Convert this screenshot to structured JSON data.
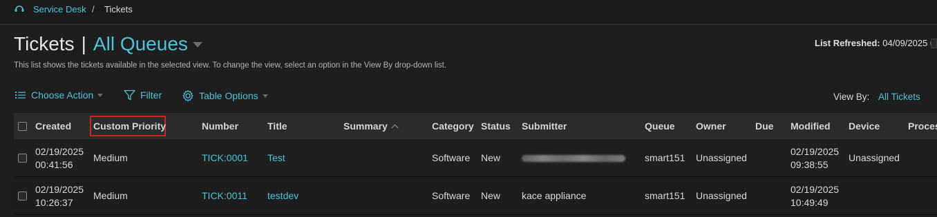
{
  "breadcrumb": {
    "home": "Service Desk",
    "separator": "/",
    "current": "Tickets"
  },
  "header": {
    "title": "Tickets",
    "divider": "|",
    "queue": "All Queues",
    "subtitle": "This list shows the tickets available in the selected view. To change the view, select an option in the View By drop-down list.",
    "refreshed_label": "List Refreshed:",
    "refreshed_value": "04/09/2025 0"
  },
  "toolbar": {
    "choose_action": "Choose Action",
    "filter": "Filter",
    "table_options": "Table Options",
    "view_by_label": "View By:",
    "view_by_value": "All Tickets"
  },
  "table": {
    "columns": [
      "Created",
      "Custom Priority",
      "Number",
      "Title",
      "Summary",
      "Category",
      "Status",
      "Submitter",
      "Queue",
      "Owner",
      "Due",
      "Modified",
      "Device",
      "Proces"
    ],
    "rows": [
      {
        "created_date": "02/19/2025",
        "created_time": "00:41:56",
        "priority": "Medium",
        "number": "TICK:0001",
        "title": "Test",
        "summary": "",
        "category": "Software",
        "status": "New",
        "submitter": "",
        "queue": "smart151",
        "owner": "Unassigned",
        "due": "",
        "modified_date": "02/19/2025",
        "modified_time": "09:38:55",
        "device": "Unassigned"
      },
      {
        "created_date": "02/19/2025",
        "created_time": "10:26:37",
        "priority": "Medium",
        "number": "TICK:0011",
        "title": "testdev",
        "summary": "",
        "category": "Software",
        "status": "New",
        "submitter": "kace appliance",
        "queue": "smart151",
        "owner": "Unassigned",
        "due": "",
        "modified_date": "02/19/2025",
        "modified_time": "10:49:49",
        "device": ""
      }
    ]
  },
  "colors": {
    "accent": "#4fc3d9",
    "highlight_border": "#c62828",
    "background": "#1e1e1e"
  }
}
